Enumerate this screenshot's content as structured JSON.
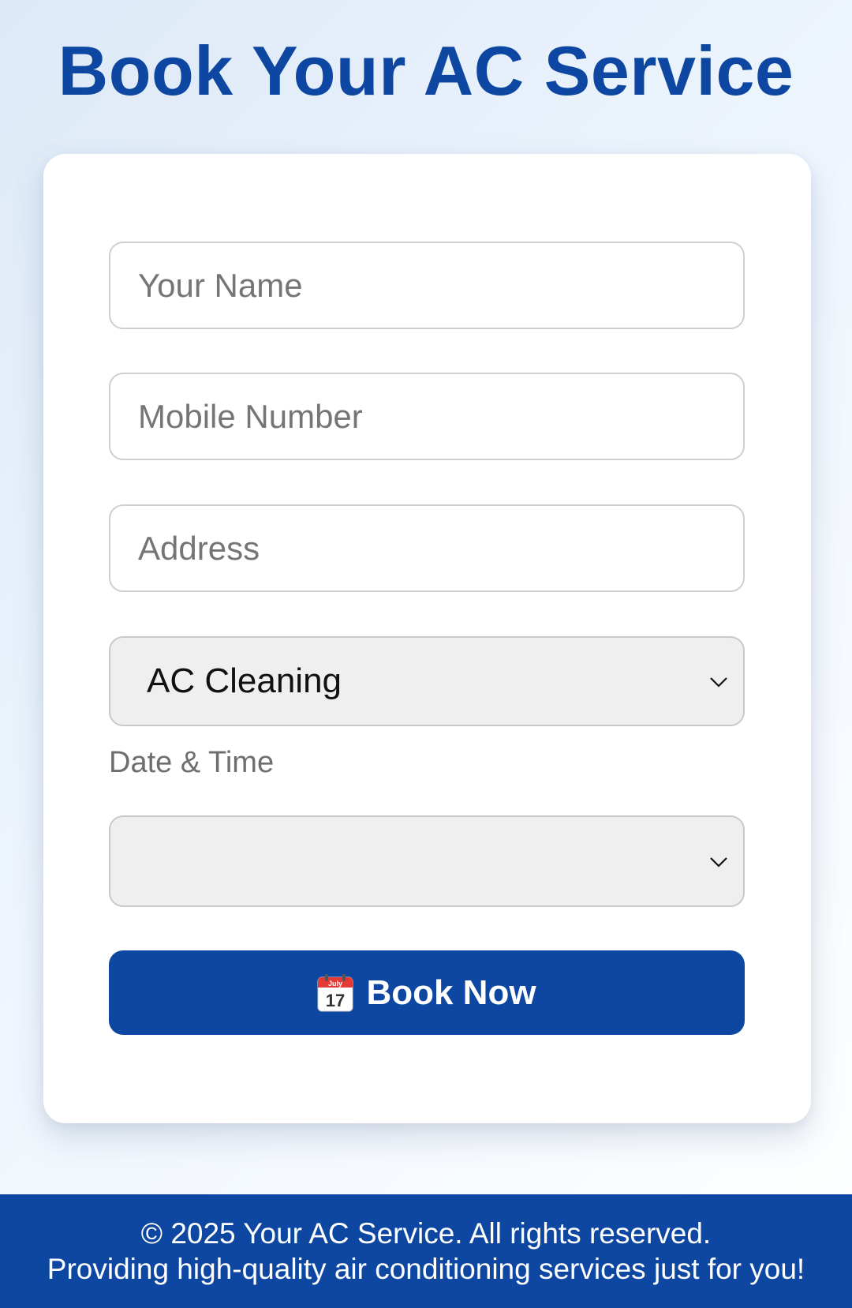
{
  "header": {
    "title": "Book Your AC Service"
  },
  "form": {
    "name_placeholder": "Your Name",
    "mobile_placeholder": "Mobile Number",
    "address_placeholder": "Address",
    "service_selected": "AC Cleaning",
    "datetime_label": "Date & Time",
    "datetime_value": "",
    "submit_label": "Book Now",
    "submit_icon": "calendar-icon",
    "calendar_month": "July",
    "calendar_day": "17"
  },
  "footer": {
    "copyright": "© 2025 Your AC Service. All rights reserved.",
    "tagline": "Providing high-quality air conditioning services just for you!"
  },
  "colors": {
    "primary": "#0d47a1",
    "calendar_red": "#e53935"
  }
}
